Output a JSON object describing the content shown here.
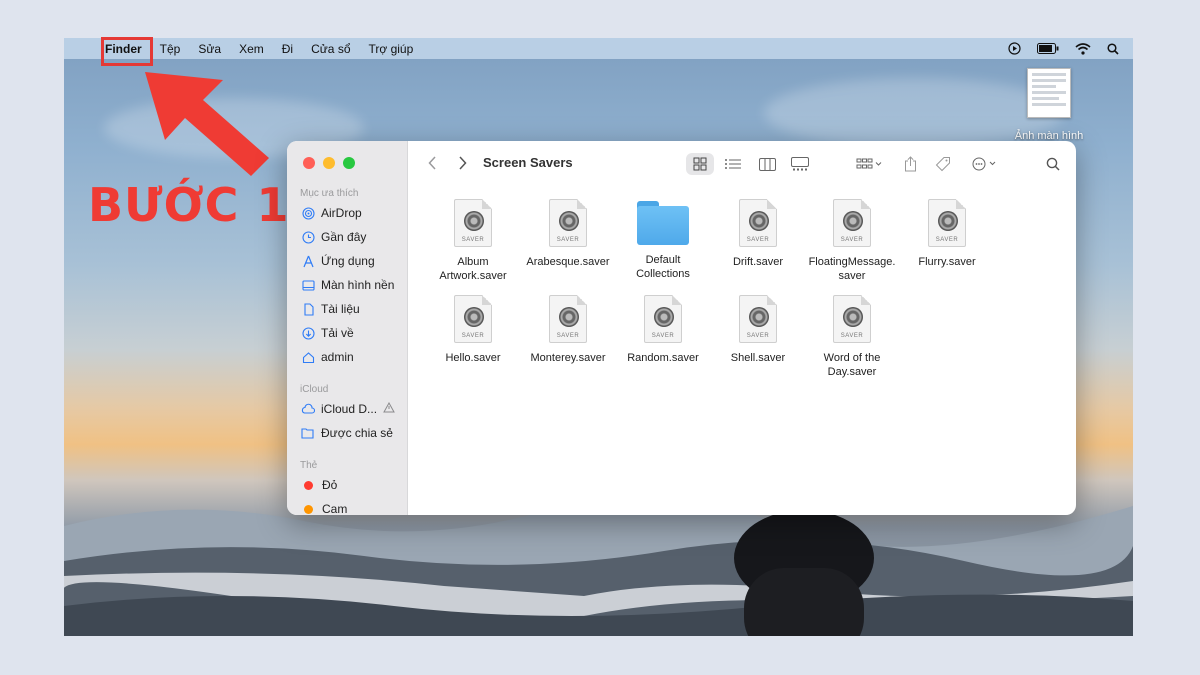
{
  "step_label": "BƯỚC 1",
  "menubar": {
    "items": [
      "Finder",
      "Tệp",
      "Sửa",
      "Xem",
      "Đi",
      "Cửa sổ",
      "Trợ giúp"
    ]
  },
  "desktop": {
    "icon_label": "Ảnh màn hình"
  },
  "finder": {
    "title": "Screen Savers",
    "sidebar": {
      "favorites_title": "Mục ưa thích",
      "favorites": [
        {
          "label": "AirDrop",
          "icon": "airdrop-icon"
        },
        {
          "label": "Gần đây",
          "icon": "clock-icon"
        },
        {
          "label": "Ứng dụng",
          "icon": "apps-icon"
        },
        {
          "label": "Màn hình nền",
          "icon": "desktop-icon"
        },
        {
          "label": "Tài liệu",
          "icon": "document-icon"
        },
        {
          "label": "Tải về",
          "icon": "download-icon"
        },
        {
          "label": "admin",
          "icon": "home-icon"
        }
      ],
      "icloud_title": "iCloud",
      "icloud": [
        {
          "label": "iCloud D...",
          "icon": "cloud-icon"
        },
        {
          "label": "Được chia sẻ",
          "icon": "shared-folder-icon"
        }
      ],
      "tags_title": "Thẻ",
      "tags": [
        {
          "label": "Đỏ",
          "color": "#ff3b30"
        },
        {
          "label": "Cam",
          "color": "#ff9500"
        }
      ]
    },
    "files": [
      {
        "name": "Album\nArtwork.saver",
        "kind": "saver",
        "badge": "SAVER"
      },
      {
        "name": "Arabesque.saver",
        "kind": "saver",
        "badge": "SAVER"
      },
      {
        "name": "Default\nCollections",
        "kind": "folder",
        "badge": ""
      },
      {
        "name": "Drift.saver",
        "kind": "saver",
        "badge": "SAVER"
      },
      {
        "name": "FloatingMessage.\nsaver",
        "kind": "saver",
        "badge": "SAVER"
      },
      {
        "name": "Flurry.saver",
        "kind": "saver",
        "badge": "SAVER"
      },
      {
        "name": "Hello.saver",
        "kind": "saver",
        "badge": "SAVER"
      },
      {
        "name": "Monterey.saver",
        "kind": "saver",
        "badge": "SAVER"
      },
      {
        "name": "Random.saver",
        "kind": "saver",
        "badge": "SAVER"
      },
      {
        "name": "Shell.saver",
        "kind": "saver",
        "badge": "SAVER"
      },
      {
        "name": "Word of the\nDay.saver",
        "kind": "saver",
        "badge": "SAVER"
      }
    ]
  }
}
